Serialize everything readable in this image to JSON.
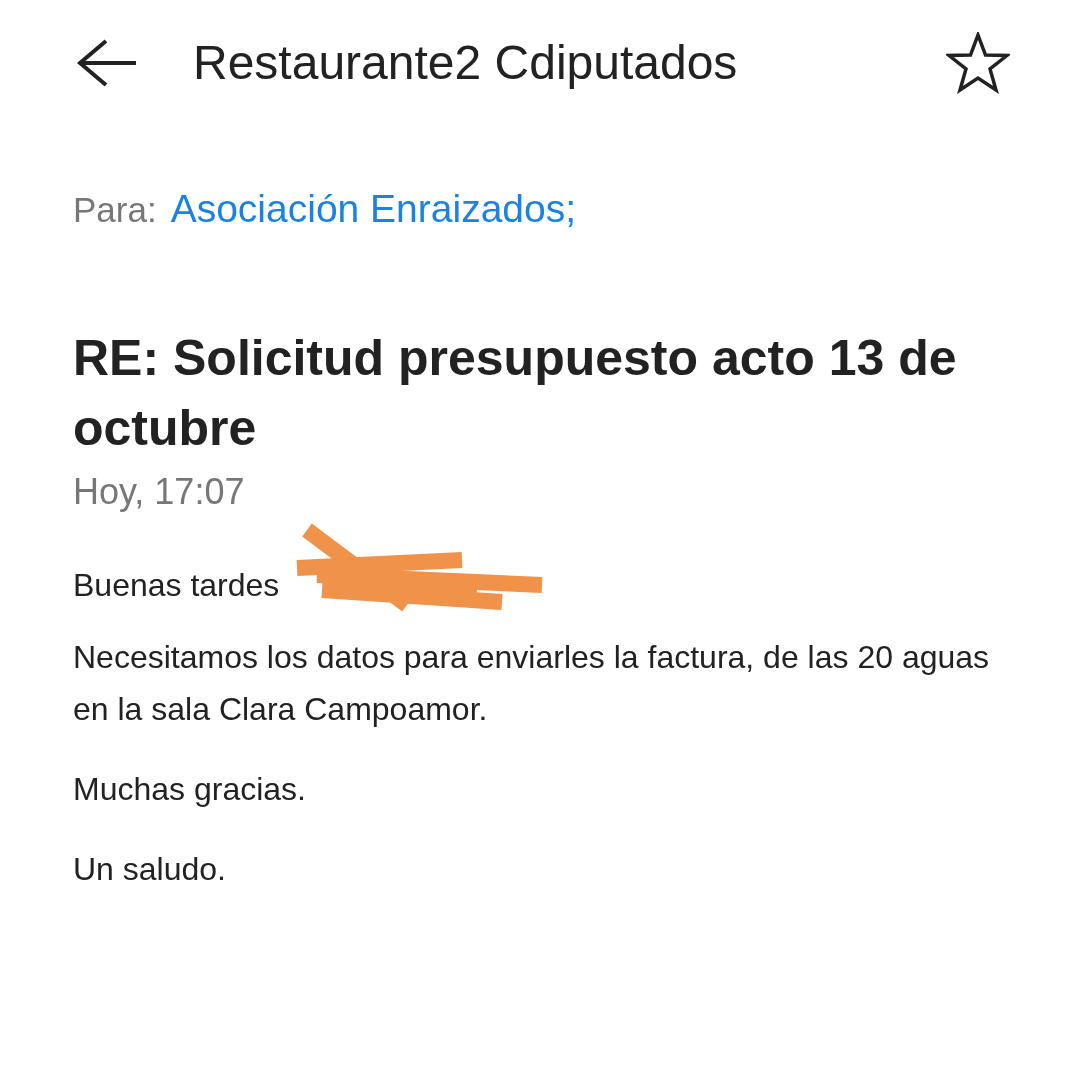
{
  "header": {
    "title": "Restaurante2 Cdiputados",
    "starred": false
  },
  "recipients": {
    "label": "Para:",
    "names": [
      "Asociación Enraizados;"
    ]
  },
  "subject": "RE: Solicitud presupuesto acto 13 de octubre",
  "date": "Hoy, 17:07",
  "body": [
    {
      "kind": "redacted",
      "text": "Buenas tardes"
    },
    {
      "kind": "text",
      "text": "Necesitamos los datos para enviarles la factura, de las 20 aguas en la sala Clara Campoamor."
    },
    {
      "kind": "text",
      "text": "Muchas gracias."
    },
    {
      "kind": "text",
      "text": "Un saludo."
    }
  ]
}
